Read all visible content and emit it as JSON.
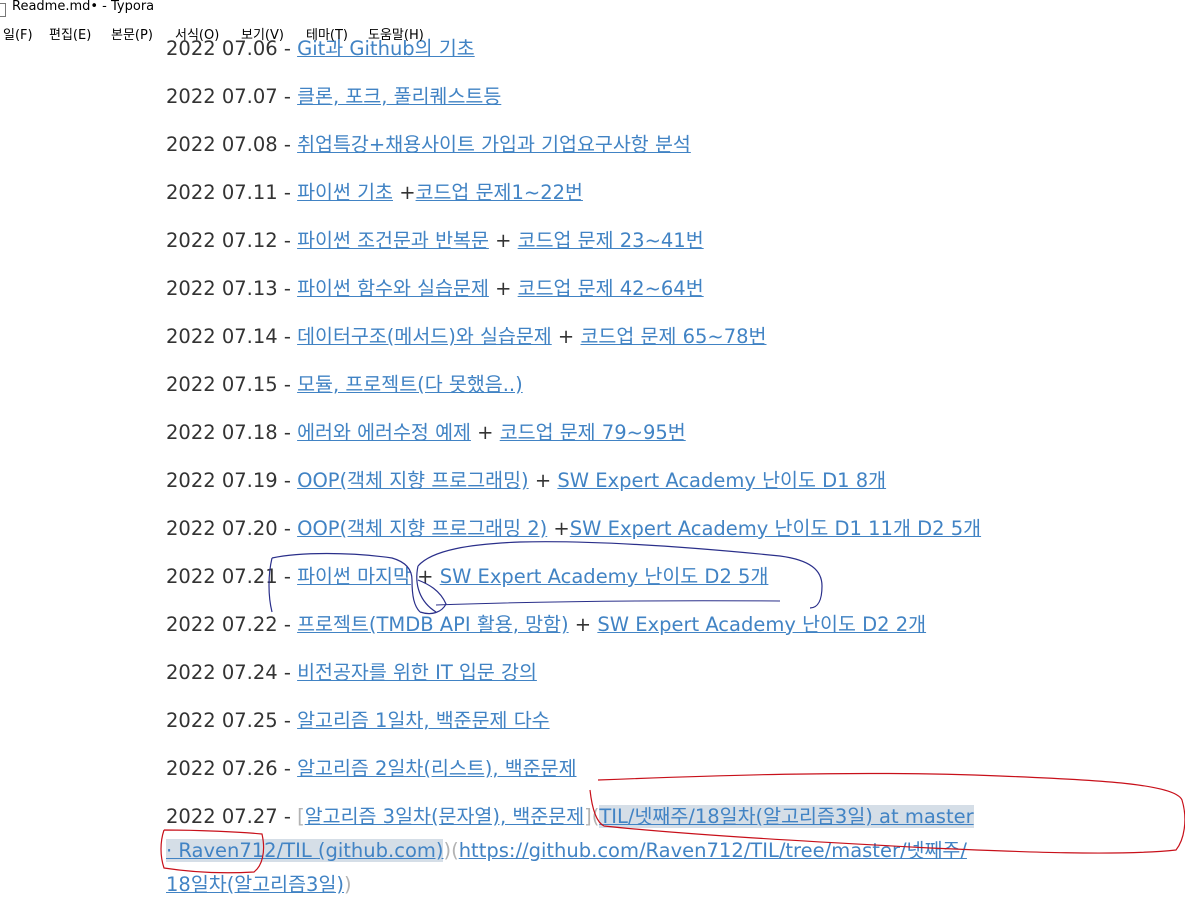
{
  "window": {
    "title": "Readme.md• - Typora"
  },
  "menu": {
    "items": [
      "일(F)",
      "편집(E)",
      "본문(P)",
      "서식(O)",
      "보기(V)",
      "테마(T)",
      "도움말(H)"
    ]
  },
  "entries": [
    {
      "date": "2022 07.06",
      "sep": " - ",
      "parts": [
        {
          "type": "link",
          "text": "Git과 Github의 기초"
        }
      ]
    },
    {
      "date": "2022 07.07",
      "sep": " - ",
      "parts": [
        {
          "type": "link",
          "text": "클론, 포크, 풀리퀘스트등"
        }
      ]
    },
    {
      "date": "2022 07.08",
      "sep": " - ",
      "parts": [
        {
          "type": "link",
          "text": "취업특강+채용사이트 가입과 기업요구사항 분석"
        }
      ]
    },
    {
      "date": "2022 07.11",
      "sep": " - ",
      "parts": [
        {
          "type": "link",
          "text": "파이썬 기초"
        },
        {
          "type": "text",
          "text": " +"
        },
        {
          "type": "link",
          "text": "코드업 문제1~22번"
        }
      ]
    },
    {
      "date": "2022 07.12",
      "sep": " - ",
      "parts": [
        {
          "type": "link",
          "text": "파이썬 조건문과 반복문"
        },
        {
          "type": "text",
          "text": " + "
        },
        {
          "type": "link",
          "text": "코드업 문제 23~41번"
        }
      ]
    },
    {
      "date": "2022 07.13",
      "sep": " - ",
      "parts": [
        {
          "type": "link",
          "text": "파이썬 함수와 실습문제"
        },
        {
          "type": "text",
          "text": " + "
        },
        {
          "type": "link",
          "text": "코드업 문제 42~64번"
        }
      ]
    },
    {
      "date": "2022 07.14",
      "sep": " - ",
      "parts": [
        {
          "type": "link",
          "text": "데이터구조(메서드)와 실습문제"
        },
        {
          "type": "text",
          "text": " + "
        },
        {
          "type": "link",
          "text": "코드업 문제 65~78번"
        }
      ]
    },
    {
      "date": "2022 07.15",
      "sep": " - ",
      "parts": [
        {
          "type": "link",
          "text": "모듈, 프로젝트(다 못했음..)"
        }
      ]
    },
    {
      "date": "2022 07.18",
      "sep": " - ",
      "parts": [
        {
          "type": "link",
          "text": "에러와 에러수정 예제"
        },
        {
          "type": "text",
          "text": " + "
        },
        {
          "type": "link",
          "text": "코드업 문제 79~95번"
        }
      ]
    },
    {
      "date": "2022 07.19",
      "sep": " - ",
      "parts": [
        {
          "type": "link",
          "text": "OOP(객체 지향 프로그래밍)"
        },
        {
          "type": "text",
          "text": " + "
        },
        {
          "type": "link",
          "text": "SW Expert Academy 난이도 D1 8개"
        }
      ]
    },
    {
      "date": "2022 07.20",
      "sep": " - ",
      "parts": [
        {
          "type": "link",
          "text": "OOP(객체 지향 프로그래밍 2)"
        },
        {
          "type": "text",
          "text": " +"
        },
        {
          "type": "link",
          "text": "SW Expert Academy 난이도 D1 11개 D2 5개"
        }
      ]
    },
    {
      "date": "2022 07.21",
      "sep": " - ",
      "parts": [
        {
          "type": "link",
          "text": "파이썬 마지막"
        },
        {
          "type": "text",
          "text": " + "
        },
        {
          "type": "link",
          "text": "SW Expert Academy 난이도 D2 5개"
        }
      ]
    },
    {
      "date": "2022 07.22",
      "sep": " - ",
      "parts": [
        {
          "type": "link",
          "text": "프로젝트(TMDB API 활용, 망함)"
        },
        {
          "type": "text",
          "text": " + "
        },
        {
          "type": "link",
          "text": "SW Expert Academy 난이도 D2 2개"
        }
      ]
    },
    {
      "date": "2022 07.24",
      "sep": " - ",
      "parts": [
        {
          "type": "link",
          "text": "비전공자를 위한 IT 입문 강의"
        }
      ]
    },
    {
      "date": "2022 07.25",
      "sep": " - ",
      "parts": [
        {
          "type": "link",
          "text": "알고리즘 1일차, 백준문제 다수"
        }
      ]
    },
    {
      "date": "2022 07.26",
      "sep": " - ",
      "parts": [
        {
          "type": "link",
          "text": "알고리즘 2일차(리스트), 백준문제"
        }
      ]
    }
  ],
  "last_entry": {
    "date": "2022 07.27",
    "sep": " - ",
    "bracket_open": "[",
    "link_text": "알고리즘 3일차(문자열), 백준문제",
    "bracket_mid": "](",
    "hl_text": "TIL/넷째주/18일차(알고리즘3일) at master · Raven712/TIL (github.com)",
    "paren_mid": ")(",
    "url": "https://github.com/Raven712/TIL/tree/master/넷째주/18일차(알고리즘3일)",
    "paren_close": ")"
  },
  "colors": {
    "link": "#4183c4",
    "text": "#333333",
    "highlight": "#d5dee7",
    "annotation_blue": "#2a2f8a",
    "annotation_red": "#c8101a"
  }
}
